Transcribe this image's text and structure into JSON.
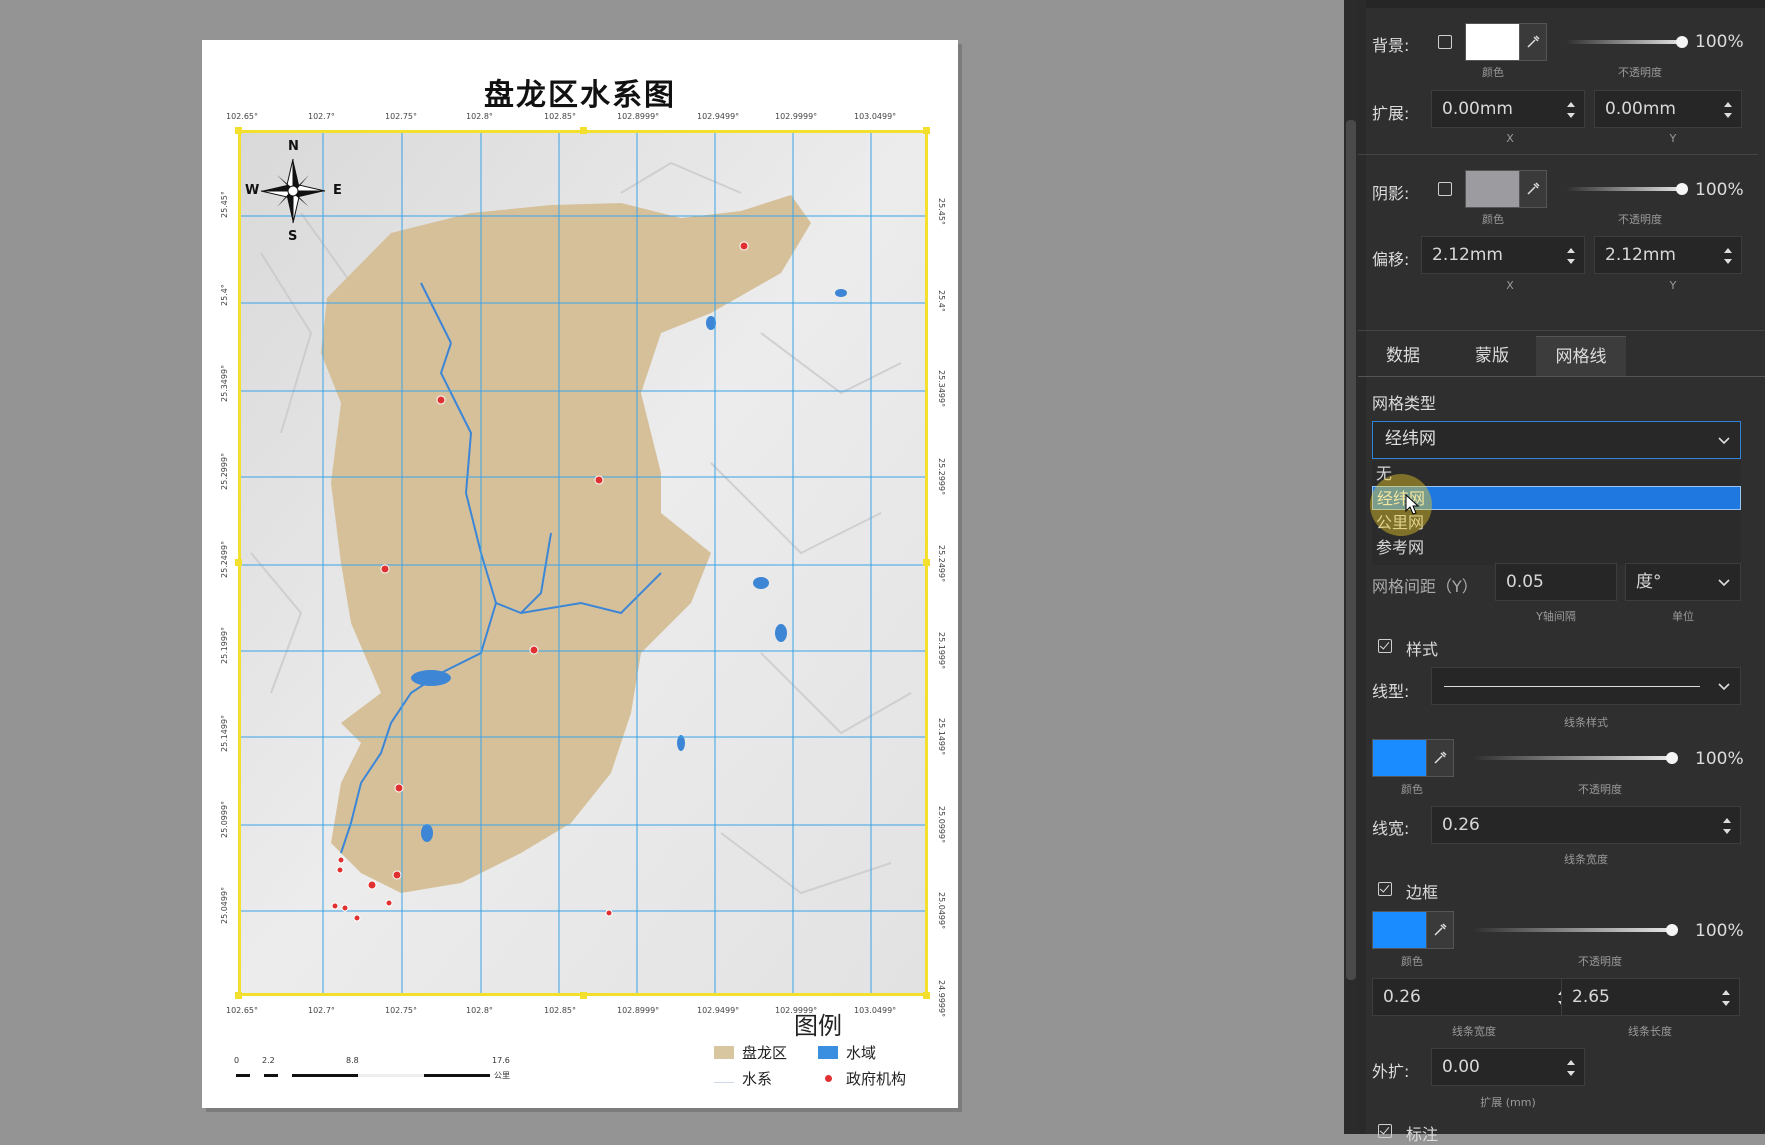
{
  "map": {
    "title": "盘龙区水系图",
    "top_coords": [
      "102.65°",
      "102.7°",
      "102.75°",
      "102.8°",
      "102.85°",
      "102.8999°",
      "102.9499°",
      "102.9999°",
      "103.0499°"
    ],
    "bottom_coords": [
      "102.65°",
      "102.7°",
      "102.75°",
      "102.8°",
      "102.85°",
      "102.8999°",
      "102.9499°",
      "102.9999°",
      "103.0499°"
    ],
    "left_coords": [
      "25.45°",
      "25.4°",
      "25.3499°",
      "25.2999°",
      "25.2499°",
      "25.1999°",
      "25.1499°",
      "25.0999°",
      "25.0499°"
    ],
    "right_coords": [
      "25.45°",
      "25.4°",
      "25.3499°",
      "25.2999°",
      "25.2499°",
      "25.1999°",
      "25.1499°",
      "25.0999°",
      "25.0499°",
      "24.9999°"
    ],
    "compass": {
      "n": "N",
      "s": "S",
      "e": "E",
      "w": "W"
    },
    "legend": {
      "title": "图例",
      "items": [
        {
          "label": "盘龙区",
          "color": "#d8c6a0"
        },
        {
          "label": "水域",
          "color": "#3b8fe0"
        },
        {
          "label": "水系",
          "color": "#cfd8e6"
        },
        {
          "label": "政府机构",
          "color": "#e03030"
        }
      ]
    },
    "scalebar": {
      "ticks": [
        "0",
        "2.2",
        "8.8",
        "17.6"
      ],
      "unit": "公里"
    },
    "colors": {
      "grid": "#39a3e8",
      "district": "#d5c09a",
      "water": "#3d86d6",
      "frame": "#f3df2e"
    }
  },
  "panel": {
    "background": {
      "label": "背景:",
      "color_label": "颜色",
      "opacity": "100%",
      "opacity_label": "不透明度",
      "color": "#ffffff"
    },
    "extend": {
      "label": "扩展:",
      "x": "0.00mm",
      "y": "0.00mm",
      "x_label": "X",
      "y_label": "Y"
    },
    "shadow": {
      "label": "阴影:",
      "color_label": "颜色",
      "opacity": "100%",
      "opacity_label": "不透明度",
      "color": "#9c9ca0"
    },
    "offset": {
      "label": "偏移:",
      "x": "2.12mm",
      "y": "2.12mm",
      "x_label": "X",
      "y_label": "Y"
    },
    "tabs": [
      "数据",
      "蒙版",
      "网格线"
    ],
    "active_tab": "网格线",
    "grid_type": {
      "label": "网格类型",
      "value": "经纬网",
      "options": [
        "无",
        "经纬网",
        "公里网",
        "参考网"
      ],
      "selected_index": 1
    },
    "grid_spacing_y": {
      "label": "网格间距（Y）",
      "value": "0.05",
      "sub": "Y轴间隔",
      "unit": "度°",
      "unit_label": "单位"
    },
    "style": {
      "label": "样式",
      "checked": true
    },
    "line_type": {
      "label": "线型:",
      "sub": "线条样式"
    },
    "line_color": {
      "color": "#1a8cff",
      "color_label": "颜色",
      "opacity": "100%",
      "opacity_label": "不透明度"
    },
    "line_width": {
      "label": "线宽:",
      "value": "0.26",
      "sub": "线条宽度"
    },
    "border": {
      "label": "边框",
      "checked": true,
      "color": "#1a8cff",
      "color_label": "颜色",
      "opacity": "100%",
      "opacity_label": "不透明度"
    },
    "border_width": {
      "value": "0.26",
      "sub": "线条宽度"
    },
    "border_length": {
      "value": "2.65",
      "sub": "线条长度"
    },
    "outer_extend": {
      "label": "外扩:",
      "value": "0.00",
      "sub": "扩展 (mm)"
    },
    "annotation": {
      "label": "标注"
    }
  }
}
